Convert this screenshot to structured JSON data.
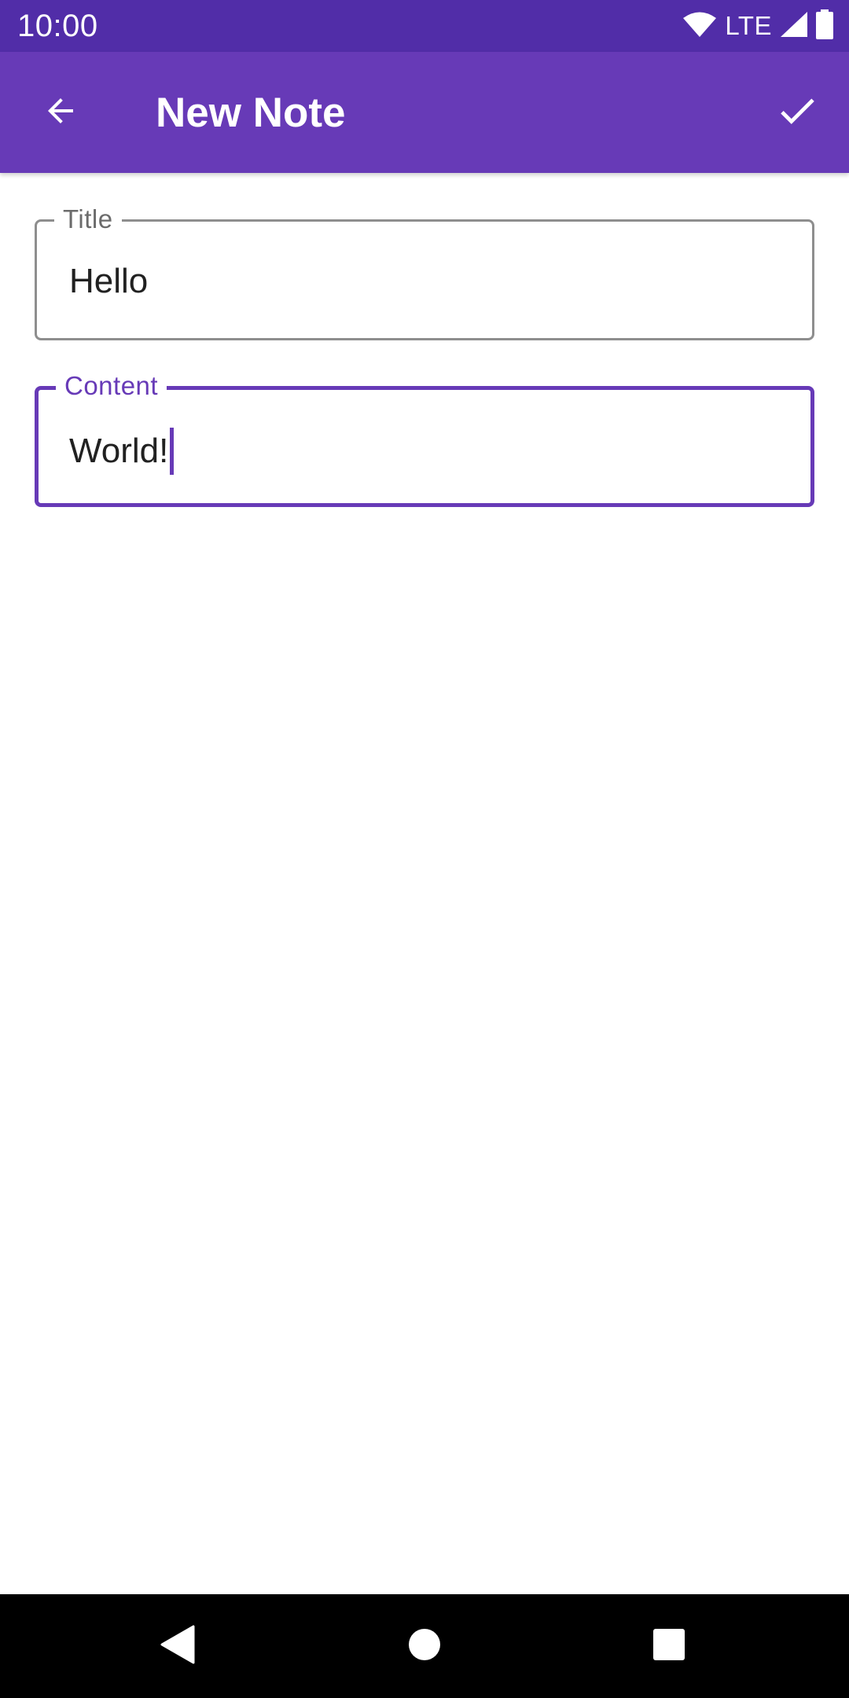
{
  "status_bar": {
    "time": "10:00",
    "network": "LTE",
    "icons": [
      "wifi-icon",
      "cell-signal-icon",
      "battery-icon"
    ]
  },
  "app_bar": {
    "title": "New Note",
    "back_icon": "arrow-back-icon",
    "save_icon": "check-icon"
  },
  "form": {
    "title_field": {
      "label": "Title",
      "value": "Hello"
    },
    "content_field": {
      "label": "Content",
      "value": "World!",
      "focused": true
    }
  },
  "nav_bar": {
    "icons": [
      "nav-back-icon",
      "nav-home-icon",
      "nav-recents-icon"
    ]
  },
  "colors": {
    "status_bar": "#512da8",
    "primary": "#673ab7",
    "outline": "#8e8e8e",
    "text": "#212121",
    "nav_bar": "#000000"
  }
}
